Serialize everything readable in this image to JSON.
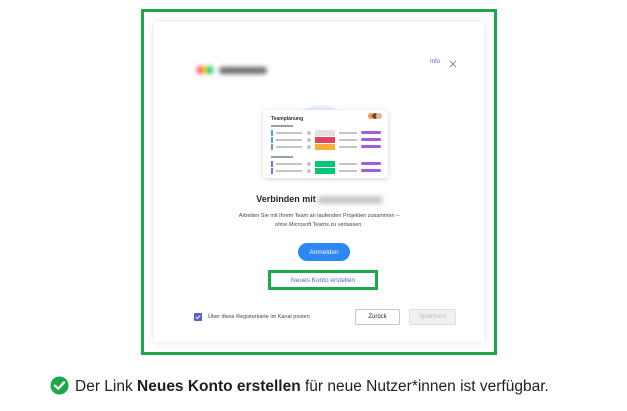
{
  "dialog": {
    "info_link": "Info",
    "board": {
      "title": "Teamplanung"
    },
    "headline_prefix": "Verbinden mit",
    "description_line1": "Arbeiten Sie mit Ihrem Team an laufenden Projekten zusammen –",
    "description_line2": "ohne Microsoft Teams zu verlassen.",
    "signin_button": "Anmelden",
    "create_account_link": "Neues Konto erstellen",
    "post_checkbox": {
      "label": "Über diese Registerkarte im Kanal posten",
      "checked": true
    },
    "back_button": "Zurück",
    "save_button": "Speichern"
  },
  "caption": {
    "before": "Der Link ",
    "bold": "Neues Konto erstellen",
    "after": " für neue Nutzer*innen ist verfügbar."
  },
  "colors": {
    "highlight": "#1aa84b",
    "accent": "#5b5fc7",
    "primary_button": "#2d87f4",
    "status_done": "#00c875",
    "status_stuck": "#e2445c",
    "status_working": "#fdab3d"
  }
}
